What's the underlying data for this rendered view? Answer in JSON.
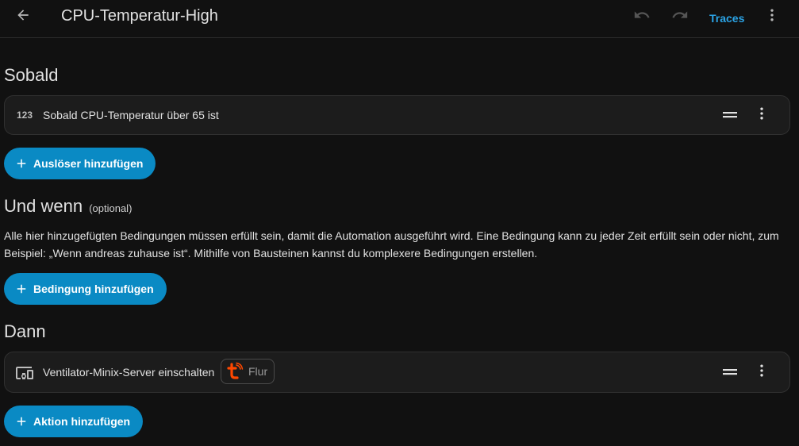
{
  "header": {
    "title": "CPU-Temperatur-High",
    "traces_label": "Traces",
    "icons": [
      "back-arrow-icon",
      "undo-icon",
      "redo-icon",
      "more-vert-icon"
    ]
  },
  "triggers": {
    "heading": "Sobald",
    "items": [
      {
        "icon": "numeric-icon",
        "icon_text": "123",
        "label": "Sobald CPU-Temperatur über 65 ist"
      }
    ],
    "add_label": "Auslöser hinzufügen"
  },
  "conditions": {
    "heading": "Und wenn",
    "optional_note": "(optional)",
    "description": "Alle hier hinzugefügten Bedingungen müssen erfüllt sein, damit die Automation ausgeführt wird. Eine Bedingung kann zu jeder Zeit erfüllt sein oder nicht, zum Beispiel: „Wenn andreas zuhause ist“. Mithilfe von Bausteinen kannst du komplexere Bedingungen erstellen.",
    "add_label": "Bedingung hinzufügen"
  },
  "actions": {
    "heading": "Dann",
    "items": [
      {
        "icon": "devices-icon",
        "label": "Ventilator-Minix-Server einschalten",
        "area_chip": {
          "logo": "tuya-logo-icon",
          "label": "Flur"
        }
      }
    ],
    "add_label": "Aktion hinzufügen"
  },
  "colors": {
    "background": "#111111",
    "card": "#1c1c1c",
    "accent_button": "#0a8ac4",
    "link": "#2ba4e6",
    "tuya_orange": "#ff4800"
  }
}
